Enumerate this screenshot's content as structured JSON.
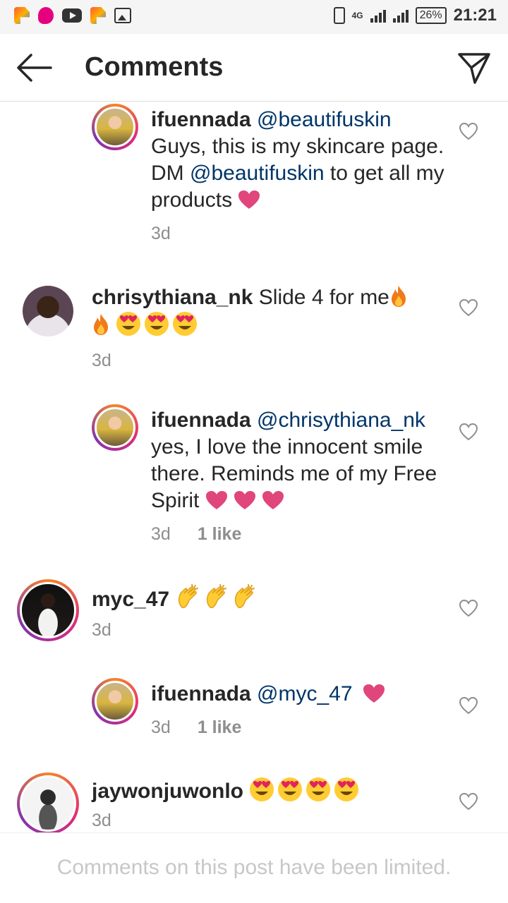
{
  "status_bar": {
    "app_icons": [
      "pinterest-like-icon",
      "picsart-icon",
      "youtube-icon",
      "pinterest-like-icon",
      "gallery-icon"
    ],
    "network": "4G",
    "battery": "26%",
    "time": "21:21"
  },
  "header": {
    "title": "Comments",
    "back_icon": "arrow-left-icon",
    "send_icon": "paper-plane-icon"
  },
  "comments": [
    {
      "username": "ifuennada",
      "mention": "@beautifuskin",
      "text_1": "Guys, this is my skincare page. DM ",
      "mention_2": "@beautifuskin",
      "text_2": " to get all my products",
      "time": "3d",
      "likes": "",
      "is_reply": true,
      "emojis": [
        "heart"
      ]
    },
    {
      "username": "chrisythiana_nk",
      "text_1": "Slide 4 for me",
      "time": "3d",
      "likes": "",
      "is_reply": false,
      "emojis": [
        "fire",
        "fire",
        "heart-eyes",
        "heart-eyes",
        "heart-eyes"
      ]
    },
    {
      "username": "ifuennada",
      "mention": "@chrisythiana_nk",
      "text_1": "yes, I love the innocent smile there. Reminds me of my Free Spirit",
      "time": "3d",
      "likes": "1 like",
      "is_reply": true,
      "emojis": [
        "heart",
        "heart",
        "heart"
      ]
    },
    {
      "username": "myc_47",
      "time": "3d",
      "likes": "",
      "is_reply": false,
      "emojis": [
        "clap",
        "clap",
        "clap"
      ]
    },
    {
      "username": "ifuennada",
      "mention": "@myc_47",
      "time": "3d",
      "likes": "1 like",
      "is_reply": true,
      "emojis": [
        "heart"
      ]
    },
    {
      "username": "jaywonjuwonlo",
      "time": "3d",
      "likes": "",
      "is_reply": false,
      "emojis": [
        "heart-eyes",
        "heart-eyes",
        "heart-eyes",
        "heart-eyes"
      ]
    }
  ],
  "footer": {
    "text": "Comments on this post have been limited."
  },
  "colors": {
    "mention": "#003569",
    "meta": "#8e8e8e",
    "heart_emoji": "#e0457b",
    "footer_text": "#c7c7c7"
  }
}
